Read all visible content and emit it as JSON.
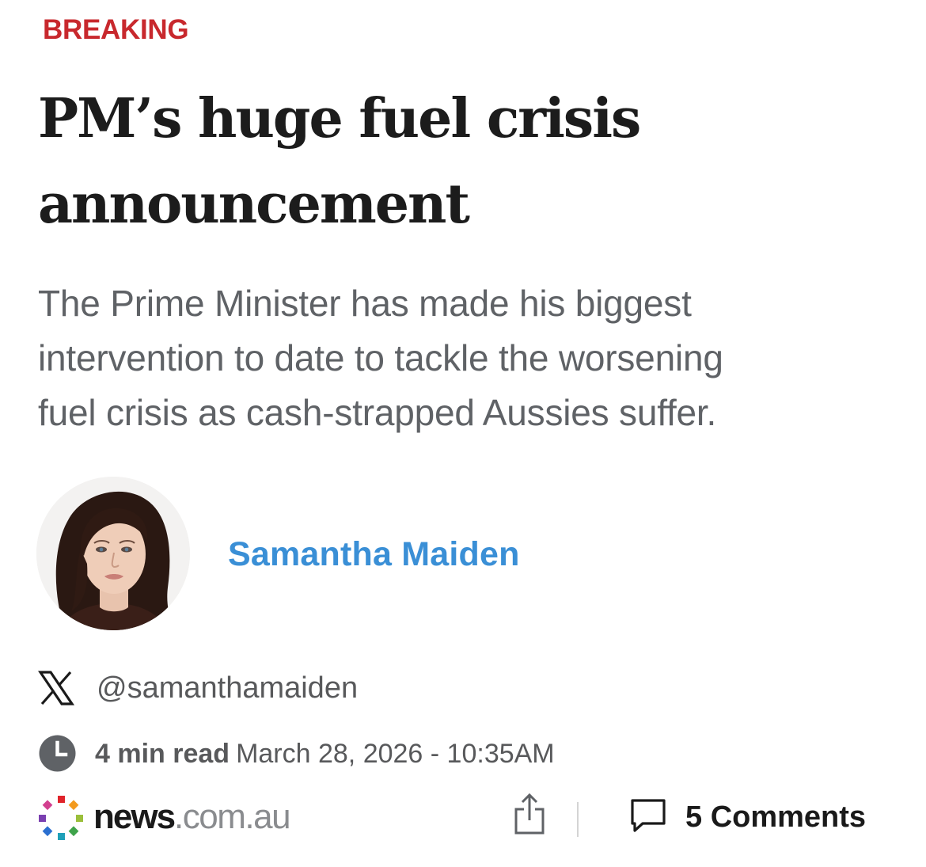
{
  "article": {
    "tag": "BREAKING",
    "headline_lines": [
      "PM’s huge fuel crisis",
      "announcement"
    ],
    "standfirst_lines": [
      "The Prime Minister has made his biggest",
      "intervention to date to tackle the worsening",
      "fuel crisis as cash-strapped Aussies suffer."
    ]
  },
  "byline": {
    "author_name": "Samantha Maiden",
    "x_handle": "@samanthamaiden",
    "read_time": "4 min read",
    "timestamp": "March 28, 2026 - 10:35AM"
  },
  "footer": {
    "logo_brand": "news",
    "logo_domain": ".com.au",
    "comments_label": "5 Comments"
  },
  "icons": {
    "x": "x-logo-icon",
    "clock": "clock-icon",
    "share": "share-icon",
    "comment": "comment-bubble-icon",
    "logo": "news-dots-logo-icon"
  },
  "colors": {
    "tag": "#c8282d",
    "author": "#3a8fd6",
    "headline": "#1c1c1c",
    "standfirst": "#5f6266",
    "meta": "#58595b"
  }
}
